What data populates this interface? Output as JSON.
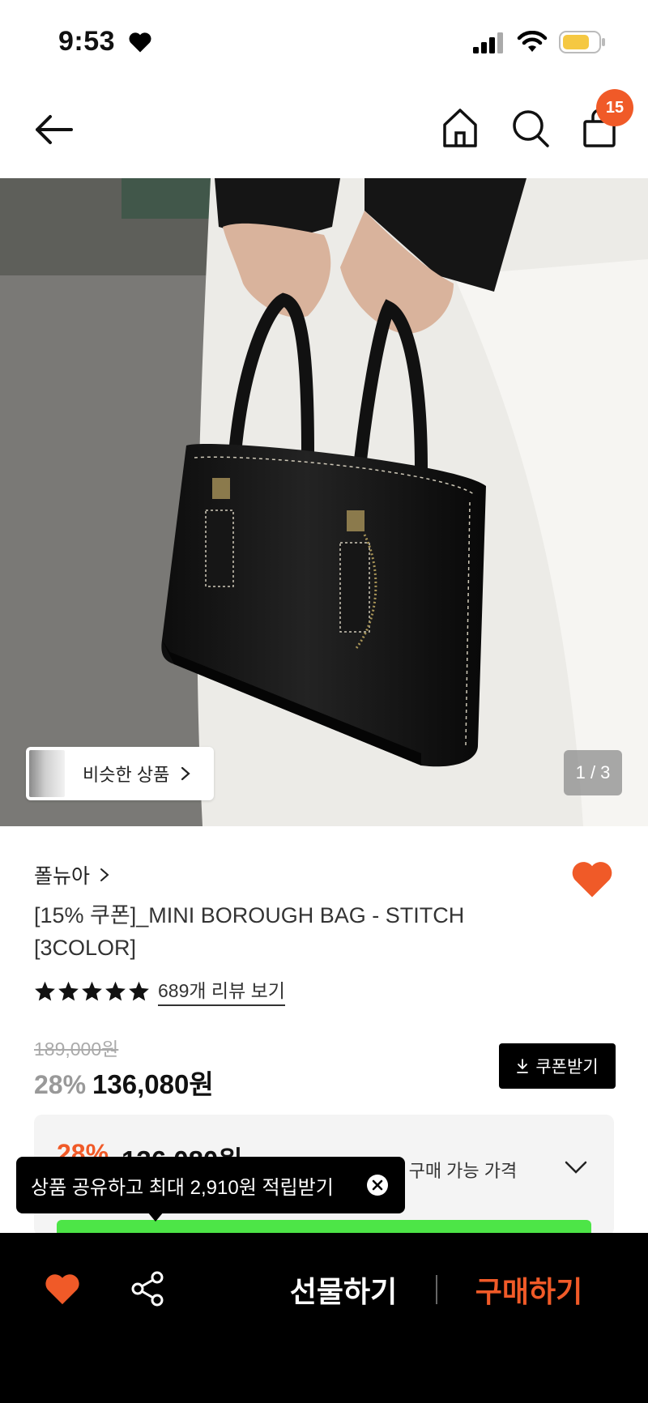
{
  "status_bar": {
    "time": "9:53",
    "icons": [
      "heart-icon",
      "signal-icon",
      "wifi-icon",
      "battery-icon"
    ],
    "battery_color": "#f5c842"
  },
  "nav": {
    "back_icon": "arrow-left-icon",
    "home_icon": "home-icon",
    "search_icon": "search-icon",
    "bag_icon": "shopping-bag-icon",
    "cart_badge": "15",
    "badge_color": "#f05a28"
  },
  "gallery": {
    "similar_label": "비슷한 상품",
    "pager": "1 / 3"
  },
  "product": {
    "brand": "폴뉴아",
    "title": "[15% 쿠폰]_MINI BOROUGH BAG - STITCH [3COLOR]",
    "rating_stars": 5,
    "reviews_link": "689개 리뷰 보기",
    "original_price": "189,000원",
    "discount": "28%",
    "price": "136,080원",
    "coupon_button": "쿠폰받기",
    "wishlisted": true,
    "accent_color": "#f05a28"
  },
  "benefit_panel": {
    "discount": "28%",
    "price": "136,080원",
    "label": "나의 구매 가능 가격"
  },
  "tooltip": {
    "text": "상품 공유하고 최대 2,910원 적립받기"
  },
  "bottom_bar": {
    "gift_label": "선물하기",
    "buy_label": "구매하기",
    "buy_color": "#f05a28"
  }
}
